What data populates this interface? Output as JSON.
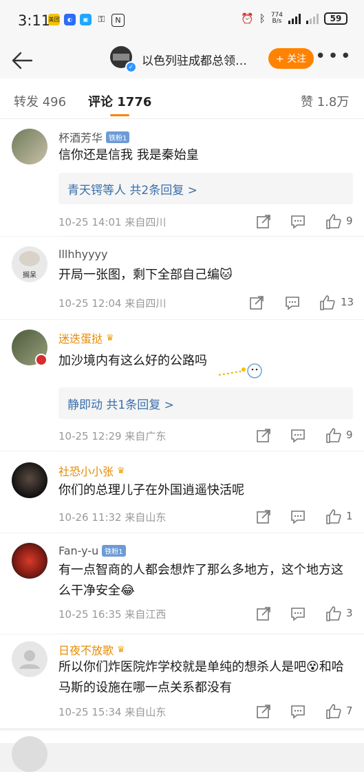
{
  "status_bar": {
    "time": "3:11",
    "app_icons": [
      "美团",
      "",
      "",
      "",
      "N"
    ],
    "net_speed_value": "774",
    "net_speed_unit": "B/s",
    "battery": "59"
  },
  "header": {
    "title": "以色列驻成都总领…",
    "follow_label": "+ 关注"
  },
  "tabs": {
    "reposts": "转发 496",
    "comments": "评论 1776",
    "likes": "赞 1.8万"
  },
  "comments": [
    {
      "name": "杯酒芳华",
      "badge": "铁粉1",
      "text": "信你还是信我 我是秦始皇",
      "reply": "青天锷等人  共2条回复  >",
      "meta": "10-25 14:01  来自四川",
      "likes": "9"
    },
    {
      "name": "lllhhyyyy",
      "badge": "",
      "avatar_label": "搁呆",
      "text": "开局一张图，剩下全部自己编🐱",
      "reply": "",
      "meta": "10-25 12:04  来自四川",
      "likes": "13"
    },
    {
      "name": "迷迭蛋挞",
      "badge": "",
      "text": "加沙境内有这么好的公路吗",
      "reply": "静即动  共1条回复  >",
      "meta": "10-25 12:29  来自广东",
      "likes": "9"
    },
    {
      "name": "社恐小小张",
      "badge": "",
      "text": "你们的总理儿子在外国逍遥快活呢",
      "reply": "",
      "meta": "10-26 11:32  来自山东",
      "likes": "1"
    },
    {
      "name": "Fan-y-u",
      "badge": "铁粉1",
      "text": "有一点智商的人都会想炸了那么多地方，这个地方这么干净安全😂",
      "reply": "",
      "meta": "10-25 16:35  来自江西",
      "likes": "3"
    },
    {
      "name": "日夜不放歌",
      "badge": "",
      "text": "所以你们炸医院炸学校就是单纯的想杀人是吧😵和哈马斯的设施在哪一点关系都没有",
      "reply": "",
      "meta": "10-25 15:34  来自山东",
      "likes": "7"
    }
  ],
  "colors": {
    "accent": "#ff8200",
    "link": "#3a6fa9",
    "vip_name": "#e88a00",
    "fan_badge": "#6d9bd6"
  }
}
